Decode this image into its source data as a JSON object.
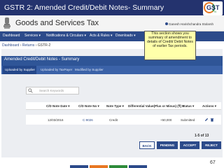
{
  "slide": {
    "title": "GSTR 2: Amended Credit/Debit Notes- Summary"
  },
  "logo": {
    "text": "GST",
    "subtext": "N"
  },
  "app": {
    "title": "Goods and Services Tax",
    "user": "Ganesh Harishchandra Stolarsh"
  },
  "nav": {
    "items": [
      "Dashboard",
      "Services ▾",
      "Notifications & Circulars ▾",
      "Acts & Rules ▾",
      "Downloads ▾"
    ]
  },
  "breadcrumb": {
    "dashboard": "Dashboard",
    "returns": "Returns",
    "current": "GSTR-2",
    "separator": " › "
  },
  "card": {
    "title": "Amended Credit/Debit Notes - Summary"
  },
  "tabs": [
    "Uploaded by Supplier",
    "Uploaded by TaxPayer",
    "Modified by Supplier"
  ],
  "search": {
    "placeholder": "Search Keywords"
  },
  "table": {
    "headers": [
      "C/D Note Date ▾",
      "C/D Note No ▾",
      "Note Type ▾",
      "Differential Value(Plus or Minus) (₹) ▾",
      "Status ▾",
      "Actions ▾"
    ],
    "rows": [
      {
        "date": "12/03/2016",
        "note_no": "C-9026",
        "type": "Credit",
        "value": "+50,000",
        "status": "Submitted"
      }
    ],
    "count": "1-5 of 13"
  },
  "buttons": {
    "back": "BACK",
    "pending": "PENDING",
    "accept": "ACCEPT",
    "reject": "REJECT"
  },
  "callout": {
    "text": "This section shows you summary of amendment to details of Credit/ Debit Notes of earlier Tax periods."
  },
  "page_number": "67",
  "colors": {
    "title_band": "#24336e",
    "nav": "#2c4a8a",
    "card_header": "#2f5597",
    "callout_bg": "#ffffaa"
  }
}
